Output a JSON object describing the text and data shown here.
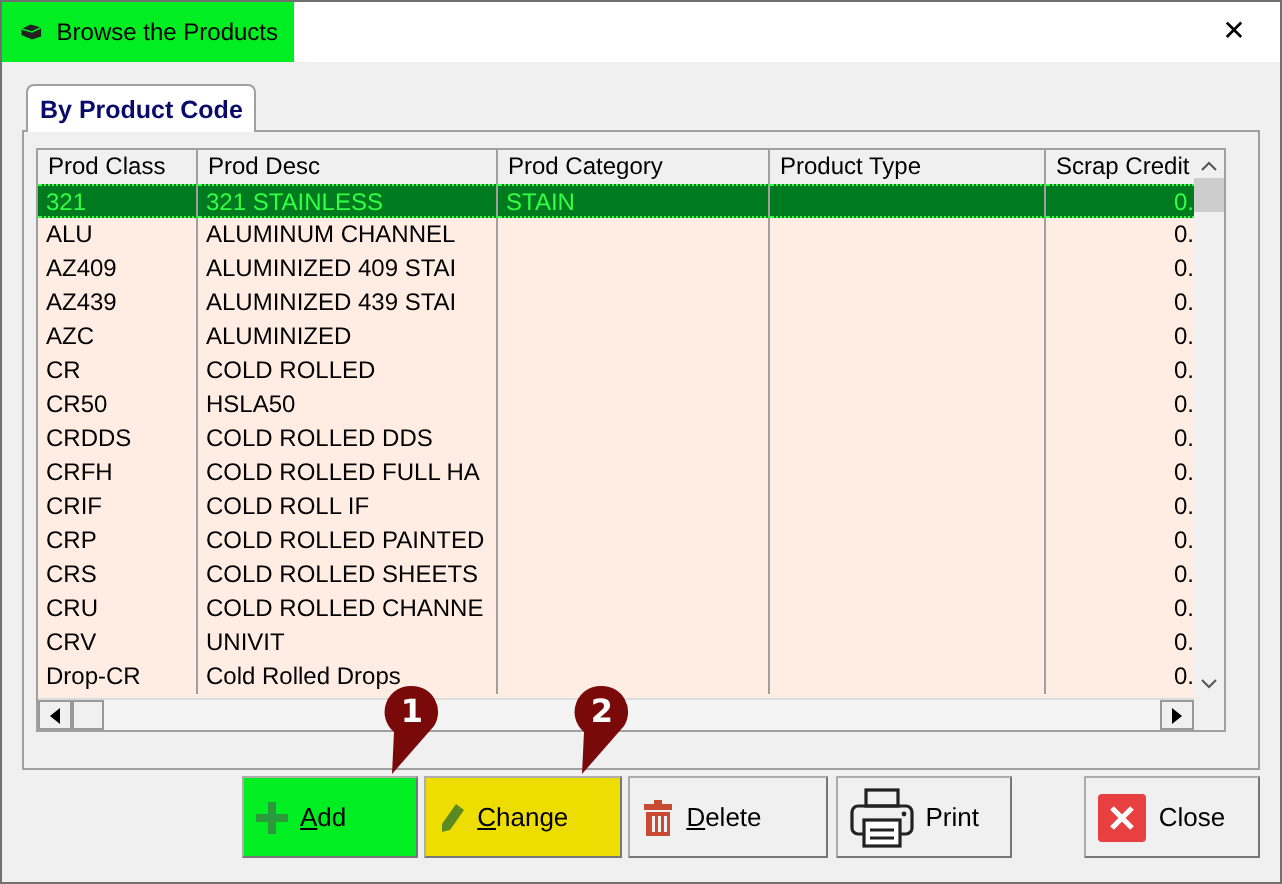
{
  "window": {
    "title": "Browse the Products",
    "close": "✕"
  },
  "tabs": [
    {
      "label": "By Product Code",
      "selected": true
    }
  ],
  "table": {
    "columns": [
      "Prod Class",
      "Prod Desc",
      "Prod Category",
      "Product Type",
      "Scrap Credit"
    ],
    "rows": [
      {
        "cells": [
          "321",
          "321 STAINLESS",
          "STAIN",
          "",
          "0."
        ],
        "selected": true
      },
      {
        "cells": [
          "ALU",
          "ALUMINUM CHANNEL",
          "",
          "",
          "0."
        ],
        "selected": false
      },
      {
        "cells": [
          "AZ409",
          "ALUMINIZED 409 STAI",
          "",
          "",
          "0."
        ],
        "selected": false
      },
      {
        "cells": [
          "AZ439",
          "ALUMINIZED 439 STAI",
          "",
          "",
          "0."
        ],
        "selected": false
      },
      {
        "cells": [
          "AZC",
          "ALUMINIZED",
          "",
          "",
          "0."
        ],
        "selected": false
      },
      {
        "cells": [
          "CR",
          "COLD ROLLED",
          "",
          "",
          "0."
        ],
        "selected": false
      },
      {
        "cells": [
          "CR50",
          "HSLA50",
          "",
          "",
          "0."
        ],
        "selected": false
      },
      {
        "cells": [
          "CRDDS",
          "COLD ROLLED DDS",
          "",
          "",
          "0."
        ],
        "selected": false
      },
      {
        "cells": [
          "CRFH",
          "COLD ROLLED FULL HA",
          "",
          "",
          "0."
        ],
        "selected": false
      },
      {
        "cells": [
          "CRIF",
          "COLD ROLL IF",
          "",
          "",
          "0."
        ],
        "selected": false
      },
      {
        "cells": [
          "CRP",
          "COLD ROLLED PAINTED",
          "",
          "",
          "0."
        ],
        "selected": false
      },
      {
        "cells": [
          "CRS",
          "COLD ROLLED SHEETS",
          "",
          "",
          "0."
        ],
        "selected": false
      },
      {
        "cells": [
          "CRU",
          "COLD ROLLED CHANNE",
          "",
          "",
          "0."
        ],
        "selected": false
      },
      {
        "cells": [
          "CRV",
          "UNIVIT",
          "",
          "",
          "0."
        ],
        "selected": false
      },
      {
        "cells": [
          "Drop-CR",
          "Cold Rolled Drops",
          "",
          "",
          "0."
        ],
        "selected": false
      }
    ]
  },
  "buttons": [
    {
      "kind": "add",
      "accel": "A",
      "rest": "dd",
      "color": "#00ee22"
    },
    {
      "kind": "change",
      "accel": "C",
      "rest": "hange",
      "color": "#eedd00"
    },
    {
      "kind": "delete",
      "accel": "D",
      "rest": "elete",
      "color": "#f0f0f0"
    },
    {
      "kind": "print",
      "rest": "Print",
      "color": "#f0f0f0"
    },
    {
      "kind": "close",
      "rest": "Close",
      "color": "#f0f0f0"
    }
  ],
  "callouts": [
    {
      "label": "1"
    },
    {
      "label": "2"
    }
  ]
}
